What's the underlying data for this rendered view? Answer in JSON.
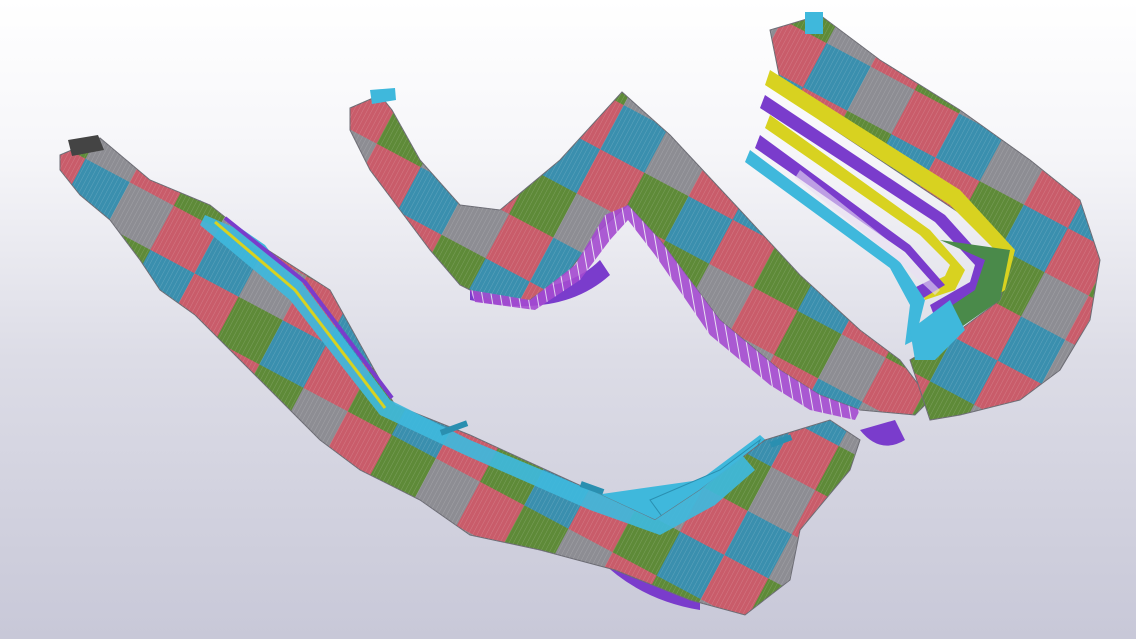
{
  "colors": {
    "panel_red": "#c95c6a",
    "panel_green": "#5e8a38",
    "panel_teal": "#3a8fae",
    "panel_gray": "#8d8d93",
    "walkway_cyan": "#3fb8dc",
    "rail_yellow": "#d8d220",
    "beam_purple": "#7a3ccc",
    "rib_magenta": "#b24cc8"
  }
}
